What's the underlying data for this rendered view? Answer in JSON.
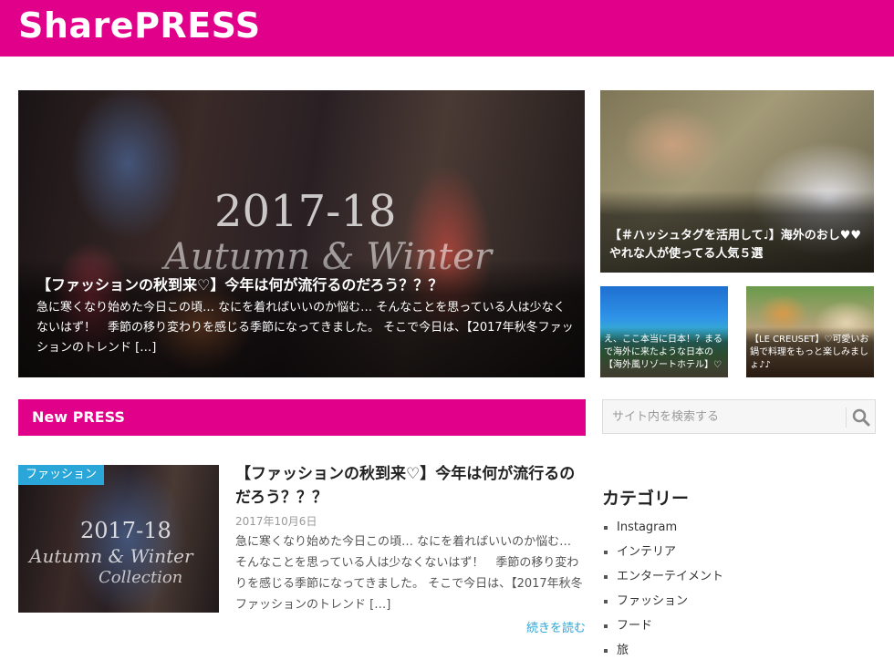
{
  "header": {
    "logo": "SharePRESS"
  },
  "featured": {
    "image_text_year": "2017-18",
    "image_text_sub": "Autumn & Winter",
    "title": "【ファッションの秋到来♡】今年は何が流行るのだろう？？？",
    "excerpt": "急に寒くなり始めた今日この頃… なにを着ればいいのか悩む… そんなことを思っている人は少なくないはず！　季節の移り変わりを感じる季節になってきました。 そこで今日は、【2017年秋冬ファッションのトレンド […]"
  },
  "side_feature": {
    "title": "【＃ハッシュタグを活用して♩】海外のおし♥♥やれな人が使ってる人気５選"
  },
  "small_features": [
    {
      "title": "え、ここ本当に日本！？まるで海外に来たような日本の【海外風リゾートホテル】♡"
    },
    {
      "title": "【LE CREUSET】♡可愛いお鍋で料理をもっと楽しみましょ♪♪"
    }
  ],
  "section": {
    "title": "New PRESS"
  },
  "search": {
    "placeholder": "サイト内を検索する",
    "icon": "search-icon"
  },
  "post": {
    "category": "ファッション",
    "image_text_year": "2017-18",
    "image_text_sub": "Autumn & Winter",
    "image_text_sub2": "Collection",
    "title": "【ファッションの秋到来♡】今年は何が流行るのだろう？？？",
    "date": "2017年10月6日",
    "excerpt": "急に寒くなり始めた今日この頃… なにを着ればいいのか悩む… そんなことを思っている人は少なくないはず！　季節の移り変わりを感じる季節になってきました。 そこで今日は、【2017年秋冬ファッションのトレンド […]",
    "read_more": "続きを読む"
  },
  "categories": {
    "heading": "カテゴリー",
    "items": [
      "Instagram",
      "インテリア",
      "エンターテイメント",
      "ファッション",
      "フード",
      "旅"
    ]
  },
  "colors": {
    "brand": "#e1008a",
    "accent": "#2aa6d8"
  }
}
